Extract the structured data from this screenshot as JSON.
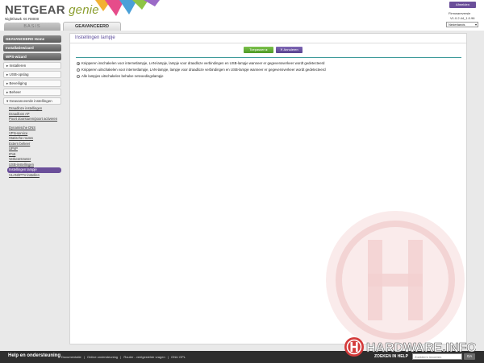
{
  "header": {
    "brand": "NETGEAR",
    "brand_suffix": " genie",
    "model": "Nighthawk X6 R8000",
    "logout_label": "Afmelden",
    "firmware_label": "Firmwareversie",
    "firmware_version": "V1.0.2.44_1.0.96",
    "language": "Nederlands"
  },
  "tabs": {
    "basic": "BASIS",
    "advanced": "GEAVANCEERD"
  },
  "sidebar": {
    "main": [
      "GEAVANCEERD Home",
      "Installatiewizard",
      "WPS-wizard"
    ],
    "sections": [
      "▸ Installeren",
      "▸ USB-opslag",
      "▸ Beveiliging",
      "▸ Beheer",
      "▾ Geavanceerde instellingen"
    ],
    "subitems": [
      "Draadloze instellingen",
      "Draadloos AP",
      "Poort doorsturen/poort activeren",
      "Dynamische DNS",
      "VPN-service",
      "Statische routes",
      "Extern beheer",
      "UPnP",
      "IPv6",
      "Verkeersmeter",
      "USB-instellingen",
      "Instellingen lampje",
      "VLAN/IPTV-instellen"
    ],
    "active_index": 11
  },
  "panel": {
    "title": "Instellingen lampje",
    "apply_label": "Toepassen ▸",
    "cancel_label": "✕ Annuleren",
    "options": [
      "Knipperen inschakelen voor internetlampje, LAN-lampje, lampje voor draadloze verbindingen en USB-lampje wanneer er gegevensverkeer wordt gedetecteerd",
      "Knipperen uitschakelen voor internetlampje, LAN-lampje, lampje voor draadloze verbindingen en USB-lampje wanneer er gegevensverkeer wordt gedetecteerd",
      "Alle lampjes uitschakelen behalve netvoedingslampje"
    ],
    "selected_option": 0
  },
  "footer": {
    "help_title": "Help en ondersteuning",
    "links": [
      "Documentatie",
      "|",
      "Online ondersteuning",
      "|",
      "Router - veelgestelde vragen",
      "|",
      "GNU GPL"
    ],
    "search_label": "ZOEKEN IN HELP",
    "search_placeholder": "Zoekterm invoeren",
    "go_label": "GA"
  },
  "watermark": {
    "text": "HARDWARE.INFO"
  },
  "colors": {
    "accent_purple": "#6b4f9a",
    "apply_green": "#5aa52e",
    "rule_teal": "#3d9a9a",
    "watermark_red": "#d43a3a"
  }
}
